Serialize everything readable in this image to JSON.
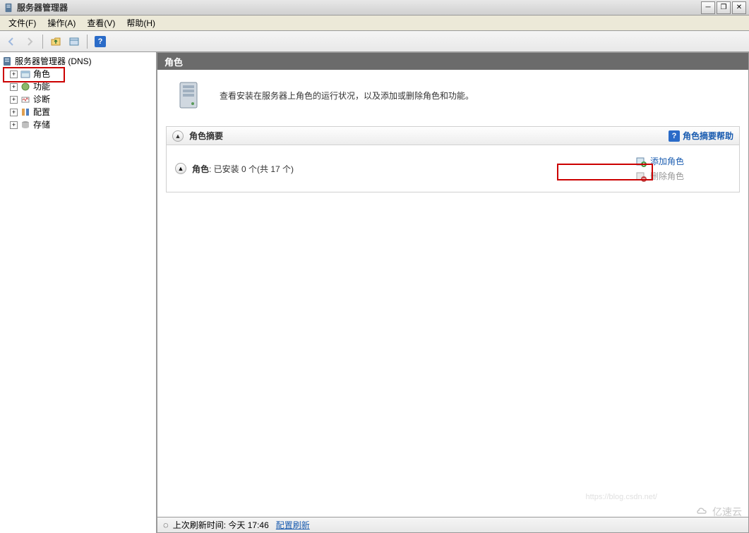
{
  "window": {
    "title": "服务器管理器"
  },
  "menus": {
    "file": "文件(F)",
    "action": "操作(A)",
    "view": "查看(V)",
    "help": "帮助(H)"
  },
  "tree": {
    "root": "服务器管理器 (DNS)",
    "items": [
      {
        "label": "角色"
      },
      {
        "label": "功能"
      },
      {
        "label": "诊断"
      },
      {
        "label": "配置"
      },
      {
        "label": "存储"
      }
    ]
  },
  "content": {
    "header": "角色",
    "description": "查看安装在服务器上角色的运行状况，以及添加或删除角色和功能。",
    "summary": {
      "title": "角色摘要",
      "help_link": "角色摘要帮助",
      "status_label": "角色",
      "status_text": ": 已安装 0 个(共 17 个)",
      "actions": {
        "add": "添加角色",
        "remove": "删除角色"
      }
    }
  },
  "statusbar": {
    "refresh_label": "上次刷新时间: 今天 17:46",
    "refresh_link": "配置刷新"
  },
  "watermark": {
    "text": "亿速云",
    "blog": "https://blog.csdn.net/"
  }
}
